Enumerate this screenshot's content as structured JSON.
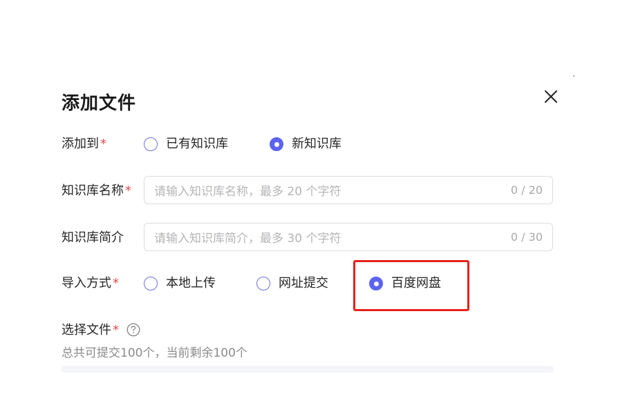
{
  "dialog": {
    "title": "添加文件",
    "close_icon": "close-icon"
  },
  "add_to": {
    "label": "添加到",
    "required_mark": "*",
    "options": [
      {
        "label": "已有知识库",
        "checked": false
      },
      {
        "label": "新知识库",
        "checked": true
      }
    ]
  },
  "kb_name": {
    "label": "知识库名称",
    "required_mark": "*",
    "placeholder": "请输入知识库名称，最多 20 个字符",
    "value": "",
    "counter": "0 / 20"
  },
  "kb_desc": {
    "label": "知识库简介",
    "placeholder": "请输入知识库简介，最多 30  个字符",
    "value": "",
    "counter": "0 / 30"
  },
  "import_method": {
    "label": "导入方式",
    "required_mark": "*",
    "options": [
      {
        "label": "本地上传",
        "checked": false
      },
      {
        "label": "网址提交",
        "checked": false
      },
      {
        "label": "百度网盘",
        "checked": true
      }
    ],
    "highlight_color": "#e8201a"
  },
  "select_file": {
    "label": "选择文件",
    "required_mark": "*",
    "help_icon": "question-circle-icon",
    "hint": "总共可提交100个，当前剩余100个"
  },
  "colors": {
    "accent": "#5b63f0",
    "required": "#f04848"
  }
}
